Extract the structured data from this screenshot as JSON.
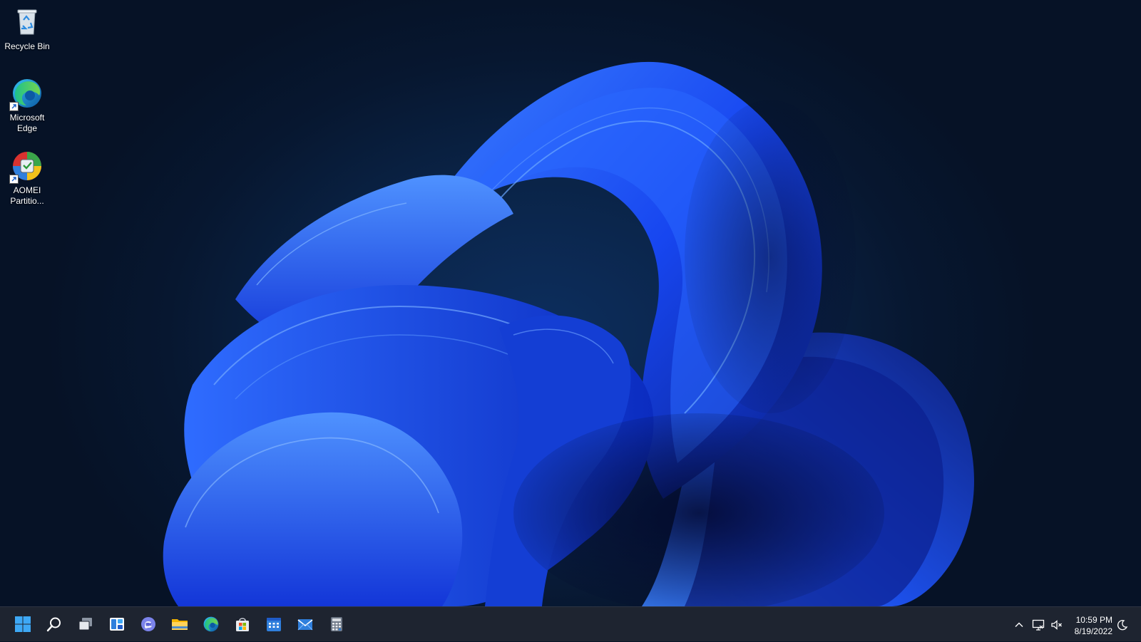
{
  "desktop": {
    "icons": [
      {
        "label": "Recycle Bin",
        "icon": "recycle-bin-icon"
      },
      {
        "label": "Microsoft\nEdge",
        "icon": "edge-icon"
      },
      {
        "label": "AOMEI\nPartitio...",
        "icon": "aomei-partition-icon"
      }
    ],
    "wallpaper": "windows-11-bloom-dark"
  },
  "taskbar": {
    "pinned": [
      {
        "name": "start",
        "icon": "windows-start-icon"
      },
      {
        "name": "search",
        "icon": "search-icon"
      },
      {
        "name": "task-view",
        "icon": "task-view-icon"
      },
      {
        "name": "widgets",
        "icon": "widgets-icon"
      },
      {
        "name": "teams-chat",
        "icon": "chat-icon"
      },
      {
        "name": "file-explorer",
        "icon": "folder-icon"
      },
      {
        "name": "edge",
        "icon": "edge-icon"
      },
      {
        "name": "microsoft-store",
        "icon": "store-icon"
      },
      {
        "name": "calendar",
        "icon": "calendar-icon"
      },
      {
        "name": "mail",
        "icon": "mail-icon"
      },
      {
        "name": "calculator",
        "icon": "calculator-icon"
      }
    ],
    "tray": {
      "time": "10:59 PM",
      "date": "8/19/2022"
    }
  },
  "colors": {
    "accent": "#1f5cff",
    "taskbar": "#1e2430",
    "background": "#071426"
  }
}
